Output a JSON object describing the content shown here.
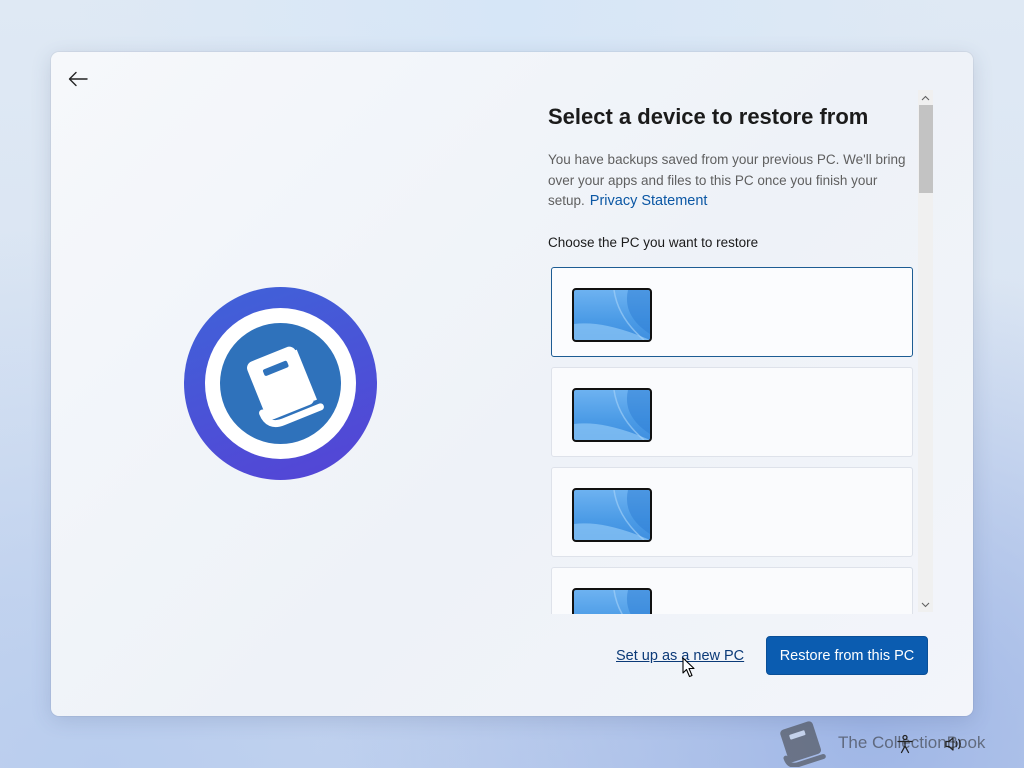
{
  "window": {
    "back_icon": "back-arrow-icon",
    "hero_icon": "book-icon"
  },
  "main": {
    "title": "Select a device to restore from",
    "description": "You have backups saved from your previous PC. We'll bring over your apps and files to this PC once you finish your setup.",
    "privacy_link": "Privacy Statement",
    "prompt": "Choose the PC you want to restore",
    "devices": [
      {
        "thumbnail": "pc-thumbnail",
        "selected": true
      },
      {
        "thumbnail": "pc-thumbnail",
        "selected": false
      },
      {
        "thumbnail": "pc-thumbnail",
        "selected": false
      },
      {
        "thumbnail": "pc-thumbnail",
        "selected": false
      }
    ]
  },
  "footer": {
    "setup_new_label": "Set up as a new PC",
    "restore_label": "Restore from this PC"
  },
  "colors": {
    "accent": "#0b5cb0",
    "hero_ring": "#4a55d8",
    "hero_center": "#2f72bb",
    "link": "#0b57a4"
  },
  "watermark": {
    "text": "The CollectionBook"
  },
  "tray": {
    "icons": [
      "accessibility-icon",
      "volume-icon"
    ]
  }
}
